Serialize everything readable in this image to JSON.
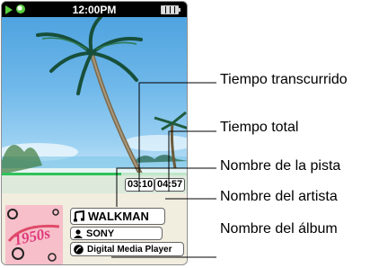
{
  "status_bar": {
    "clock": "12:00PM"
  },
  "playback": {
    "elapsed": "03:10",
    "total": "04:57",
    "progress_fraction": 0.64
  },
  "track_info": {
    "title": "WALKMAN",
    "artist": "SONY",
    "album": "Digital Media Player",
    "album_art_text": "1950s"
  },
  "callouts": {
    "elapsed": "Tiempo transcurrido",
    "total": "Tiempo total",
    "track": "Nombre de la pista",
    "artist": "Nombre del artista",
    "album": "Nombre del álbum"
  },
  "colors": {
    "accent_green": "#2ec25a",
    "sky": "#4fa3df"
  }
}
